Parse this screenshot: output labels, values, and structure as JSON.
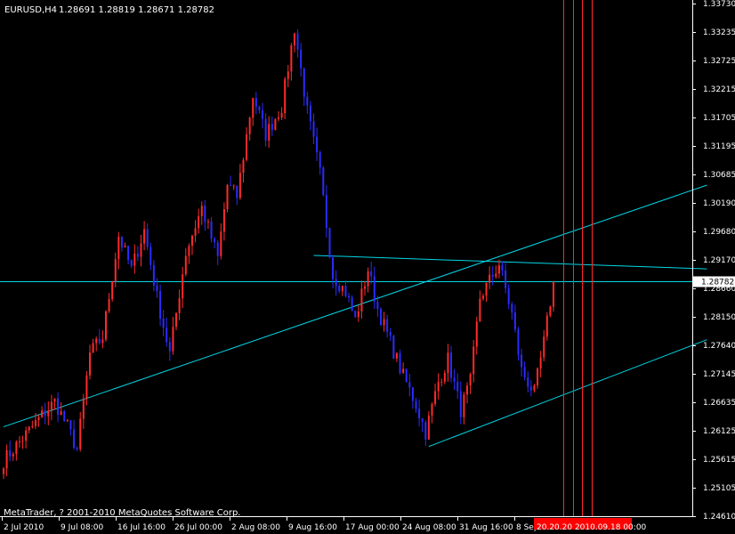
{
  "header": {
    "symbol": "EURUSD,H4",
    "ohlc": "1.28691 1.28819 1.28671 1.28782"
  },
  "footer": {
    "copyright": "MetaTrader, ? 2001-2010 MetaQuotes Software Corp."
  },
  "colors": {
    "background": "#000000",
    "up": "#ff2a2a",
    "down": "#2b2bff",
    "trendline": "#00d7e6",
    "vline": "#ff2a2a",
    "axis": "#ffffff"
  },
  "vline_label": "20.20.20 2010.09.18 00:00",
  "chart_data": {
    "type": "candlestick",
    "symbol": "EURUSD",
    "timeframe": "H4",
    "current_price": 1.28782,
    "y_ticks": [
      "1.33730",
      "1.33235",
      "1.32725",
      "1.32215",
      "1.31705",
      "1.31195",
      "1.30685",
      "1.30190",
      "1.29680",
      "1.29170",
      "1.28660",
      "1.28150",
      "1.27640",
      "1.27145",
      "1.26635",
      "1.26125",
      "1.25615",
      "1.25105",
      "1.24610"
    ],
    "ylim": [
      1.2461,
      1.3373
    ],
    "x_ticks": [
      "2 Jul 2010",
      "9 Jul 08:00",
      "16 Jul 16:00",
      "26 Jul 00:00",
      "2 Aug 08:00",
      "9 Aug 16:00",
      "17 Aug 00:00",
      "24 Aug 08:00",
      "31 Aug 16:00",
      "8 Sep"
    ],
    "price_anchors": [
      [
        0,
        1.256
      ],
      [
        6,
        1.26
      ],
      [
        12,
        1.264
      ],
      [
        16,
        1.2665
      ],
      [
        20,
        1.262
      ],
      [
        23,
        1.258
      ],
      [
        27,
        1.275
      ],
      [
        31,
        1.278
      ],
      [
        36,
        1.296
      ],
      [
        40,
        1.29
      ],
      [
        44,
        1.297
      ],
      [
        48,
        1.285
      ],
      [
        52,
        1.275
      ],
      [
        57,
        1.293
      ],
      [
        62,
        1.301
      ],
      [
        67,
        1.292
      ],
      [
        70,
        1.305
      ],
      [
        73,
        1.303
      ],
      [
        78,
        1.321
      ],
      [
        82,
        1.314
      ],
      [
        87,
        1.319
      ],
      [
        91,
        1.333
      ],
      [
        95,
        1.318
      ],
      [
        99,
        1.307
      ],
      [
        103,
        1.289
      ],
      [
        107,
        1.286
      ],
      [
        110,
        1.281
      ],
      [
        114,
        1.29
      ],
      [
        117,
        1.283
      ],
      [
        121,
        1.277
      ],
      [
        125,
        1.271
      ],
      [
        129,
        1.266
      ],
      [
        132,
        1.261
      ],
      [
        136,
        1.27
      ],
      [
        139,
        1.274
      ],
      [
        143,
        1.265
      ],
      [
        146,
        1.27
      ],
      [
        149,
        1.285
      ],
      [
        152,
        1.288
      ],
      [
        155,
        1.291
      ],
      [
        159,
        1.282
      ],
      [
        162,
        1.272
      ],
      [
        166,
        1.268
      ],
      [
        169,
        1.277
      ],
      [
        172,
        1.2878
      ]
    ],
    "trendlines": [
      {
        "from": [
          0,
          1.262
        ],
        "to": [
          220,
          1.305
        ]
      },
      {
        "from": [
          97,
          1.2925
        ],
        "to": [
          220,
          1.2901
        ]
      },
      {
        "from": [
          133,
          1.2585
        ],
        "to": [
          220,
          1.2775
        ]
      }
    ],
    "horizontal_line": 1.28782,
    "vertical_lines_bar": [
      175,
      178,
      181,
      184
    ]
  }
}
